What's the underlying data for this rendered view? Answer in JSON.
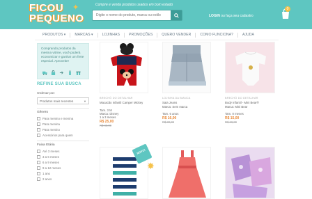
{
  "header": {
    "logo_line1": "FICOU",
    "logo_line2": "PEQUENO",
    "tagline": "Compre e venda produtos usados em bom estado",
    "search_placeholder": "Digite o nome do produto, marca ou estilo",
    "login_text": "LOGIN",
    "signup_text": "ou faça seu cadastro",
    "cart_count": "0"
  },
  "nav": [
    "PRODUTOS ▾",
    "MARCAS ▾",
    "LOJINHAS",
    "PROMOÇÕES",
    "QUERO VENDER",
    "COMO FUNCIONA?",
    "AJUDA"
  ],
  "promo": {
    "text": "Comprando produtos da mesma vitrine, você poderá economizar e ganhar um frete especial. Aproveite!"
  },
  "refine_title": "REFINE SUA BUSCA",
  "order": {
    "label": "Ordenar por:",
    "value": "Produtos mais recentes"
  },
  "genero": {
    "title": "Gênero",
    "options": [
      "Para menino e menina",
      "Para menina",
      "Para menino",
      "Acessórios para quem"
    ]
  },
  "faixa": {
    "title": "Faixa Etária",
    "options": [
      "Até 3 meses",
      "3 a 6 meses",
      "6 a 9 meses",
      "9 a 12 meses",
      "1 ano",
      "2 anos"
    ]
  },
  "products": [
    {
      "store": "BRECHÓ DO DETALHAR",
      "title": "Macacão Infantil Camper Mickey",
      "size": "Tam. 3 M",
      "extra": "Marca: Disney",
      "cond": "1 a 3 meses",
      "price": "R$ 25,00",
      "old": "R$ 45,00"
    },
    {
      "store": "LOJINHA DA BIANCA",
      "title": "Saia Jeans",
      "size": "Marca: Sem marca",
      "extra": "",
      "cond": "Tam. 6 anos",
      "price": "R$ 16,00",
      "old": "R$ 30,00"
    },
    {
      "store": "BRECHÓ DO DETALHAR",
      "title": "Body Infantil - Mini Bear®",
      "size": "Marca: Mini Bear",
      "extra": "",
      "cond": "Tam. 0 meses",
      "price": "R$ 15,00",
      "old": "R$ 28,00"
    }
  ],
  "new_badge": "NOVO!",
  "colors": {
    "teal": "#5ec6c1",
    "orange": "#e88a3a",
    "yellow": "#f6c24b"
  }
}
